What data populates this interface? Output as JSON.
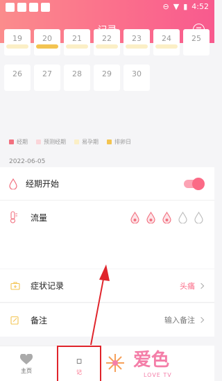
{
  "status_bar": {
    "time": "4:52"
  },
  "header": {
    "title": "记录",
    "right_icon": "clock-menu-icon"
  },
  "calendar": {
    "rows": [
      [
        {
          "day": "19",
          "bar": "light"
        },
        {
          "day": "20",
          "bar": "ovulation"
        },
        {
          "day": "21",
          "bar": "light"
        },
        {
          "day": "22",
          "bar": "light"
        },
        {
          "day": "23",
          "bar": "light"
        },
        {
          "day": "24",
          "bar": "light"
        },
        {
          "day": "25",
          "bar": "none"
        }
      ],
      [
        {
          "day": "26",
          "bar": "none"
        },
        {
          "day": "27",
          "bar": "none"
        },
        {
          "day": "28",
          "bar": "none"
        },
        {
          "day": "29",
          "bar": "none"
        },
        {
          "day": "30",
          "bar": "none"
        }
      ]
    ]
  },
  "legend": [
    {
      "label": "经期",
      "color": "#f2707f"
    },
    {
      "label": "预测经期",
      "color": "#fbd5d9"
    },
    {
      "label": "易孕期",
      "color": "#fbefc6"
    },
    {
      "label": "排卵日",
      "color": "#f3c451"
    }
  ],
  "selected_date": "2022-06-05",
  "period_start": {
    "label": "经期开始",
    "enabled": true
  },
  "flow": {
    "label": "流量",
    "level": 3,
    "max": 5
  },
  "symptoms": {
    "label": "症状记录",
    "value": "头痛"
  },
  "notes": {
    "label": "备注",
    "placeholder": "输入备注"
  },
  "nav": {
    "home_label": "主页",
    "record_label": "记"
  },
  "watermark": {
    "brand": "爱色",
    "sub": "LOVE TV"
  },
  "colors": {
    "accent": "#fb6a86",
    "header_start": "#fb8c8c",
    "header_end": "#f85a8e"
  }
}
